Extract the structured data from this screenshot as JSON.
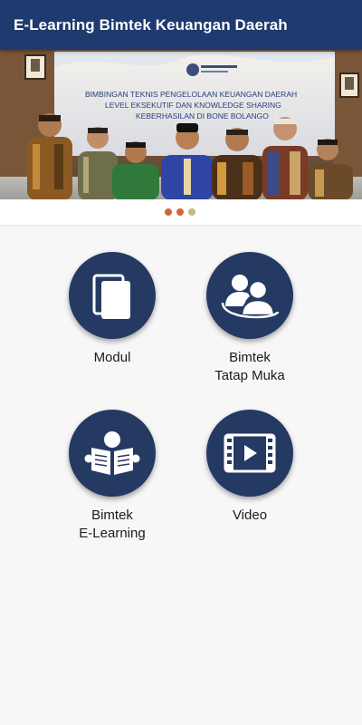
{
  "app_bar": {
    "title": "E-Learning Bimtek Keuangan Daerah"
  },
  "banner": {
    "line1": "BIMBINGAN TEKNIS PENGELOLAAN KEUANGAN DAERAH",
    "line2": "LEVEL EKSEKUTIF DAN KNOWLEDGE SHARING",
    "line3": "KEBERHASILAN DI BONE BOLANGO",
    "pager": {
      "count": 3,
      "active_index": 0
    }
  },
  "colors": {
    "app_bar": "#1f3a6e",
    "menu_circle": "#243a63",
    "dot_1": "#d4633d",
    "dot_2": "#d4633d",
    "dot_3": "#c6ba7a"
  },
  "menu": [
    {
      "label": "Modul",
      "icon": "book-stack-icon"
    },
    {
      "label": "Bimtek\nTatap Muka",
      "icon": "group-meeting-icon"
    },
    {
      "label": "Bimtek\nE-Learning",
      "icon": "reader-book-icon"
    },
    {
      "label": "Video",
      "icon": "video-play-icon"
    }
  ]
}
